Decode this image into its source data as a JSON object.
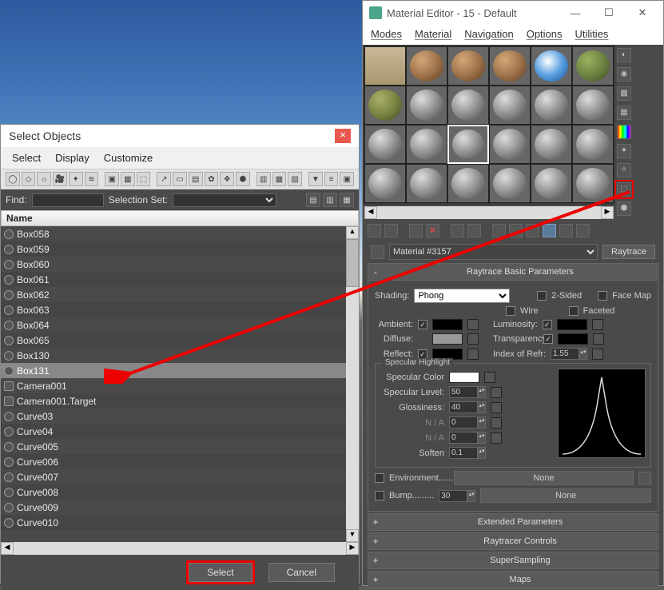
{
  "select_dialog": {
    "title": "Select Objects",
    "menu": [
      "Select",
      "Display",
      "Customize"
    ],
    "find_label": "Find:",
    "find_value": "",
    "selset_label": "Selection Set:",
    "name_header": "Name",
    "objects": [
      {
        "name": "Box058",
        "type": "geo"
      },
      {
        "name": "Box059",
        "type": "geo"
      },
      {
        "name": "Box060",
        "type": "geo"
      },
      {
        "name": "Box061",
        "type": "geo"
      },
      {
        "name": "Box062",
        "type": "geo"
      },
      {
        "name": "Box063",
        "type": "geo"
      },
      {
        "name": "Box064",
        "type": "geo"
      },
      {
        "name": "Box065",
        "type": "geo"
      },
      {
        "name": "Box130",
        "type": "geo"
      },
      {
        "name": "Box131",
        "type": "geo",
        "selected": true
      },
      {
        "name": "Camera001",
        "type": "cam"
      },
      {
        "name": "Camera001.Target",
        "type": "cam"
      },
      {
        "name": "Curve03",
        "type": "geo"
      },
      {
        "name": "Curve04",
        "type": "geo"
      },
      {
        "name": "Curve005",
        "type": "geo"
      },
      {
        "name": "Curve006",
        "type": "geo"
      },
      {
        "name": "Curve007",
        "type": "geo"
      },
      {
        "name": "Curve008",
        "type": "geo"
      },
      {
        "name": "Curve009",
        "type": "geo"
      },
      {
        "name": "Curve010",
        "type": "geo"
      }
    ],
    "buttons": {
      "select": "Select",
      "cancel": "Cancel"
    }
  },
  "mat_editor": {
    "title": "Material Editor - 15 - Default",
    "menu": [
      "Modes",
      "Material",
      "Navigation",
      "Options",
      "Utilities"
    ],
    "name_field": "Material #3157",
    "type_button": "Raytrace",
    "rollouts": {
      "basic": {
        "title": "Raytrace Basic Parameters",
        "shading_label": "Shading:",
        "shading_value": "Phong",
        "twosided": "2-Sided",
        "wire": "Wire",
        "facemap": "Face Map",
        "faceted": "Faceted",
        "ambient": "Ambient:",
        "luminosity": "Luminosity:",
        "diffuse": "Diffuse:",
        "transparency": "Transparency:",
        "reflect": "Reflect:",
        "ior_label": "Index of Refr:",
        "ior_value": "1.55",
        "spec_title": "Specular Highlight",
        "spec_color": "Specular Color",
        "spec_level_label": "Specular Level:",
        "spec_level": "50",
        "gloss_label": "Glossiness:",
        "gloss": "40",
        "na": "N / A",
        "soften_label": "Soften",
        "soften": "0.1",
        "env_label": "Environment",
        "bump_label": "Bump",
        "bump_value": "30",
        "none": "None"
      },
      "collapsed": [
        "Extended Parameters",
        "Raytracer Controls",
        "SuperSampling",
        "Maps"
      ]
    }
  }
}
